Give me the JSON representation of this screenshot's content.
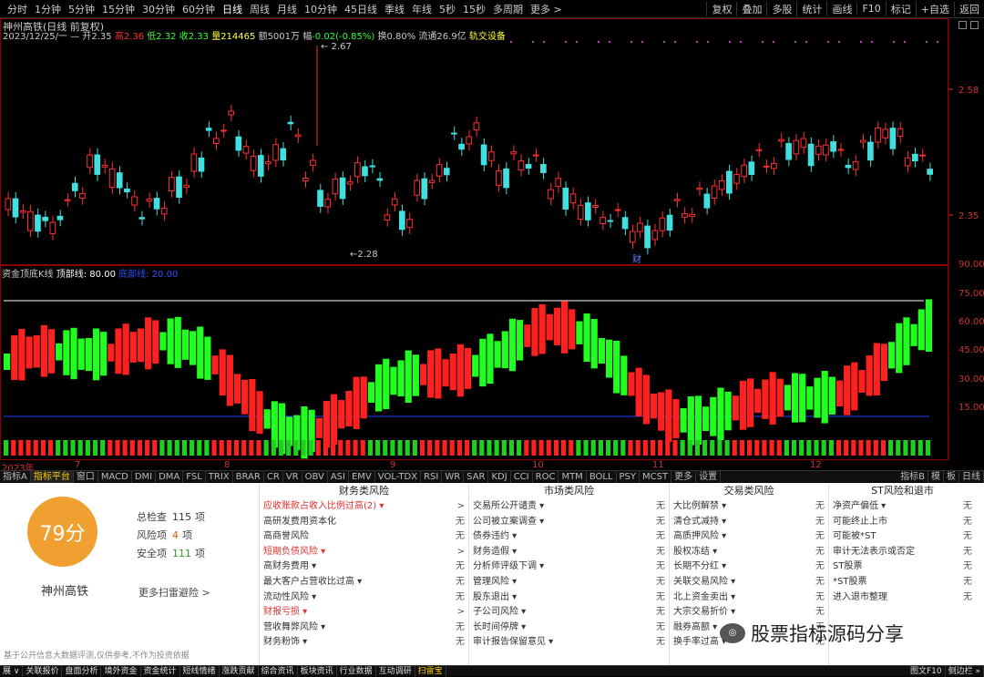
{
  "toolbar": {
    "periods": [
      "分时",
      "1分钟",
      "5分钟",
      "15分钟",
      "30分钟",
      "60分钟",
      "日线",
      "周线",
      "月线",
      "10分钟",
      "45日线",
      "季线",
      "年线",
      "5秒",
      "15秒",
      "多周期",
      "更多 >"
    ],
    "active_period": "日线",
    "right_buttons": [
      "复权",
      "叠加",
      "多股",
      "统计",
      "画线",
      "F10",
      "标记",
      "+自选",
      "返回"
    ]
  },
  "info": {
    "title": "神州高铁(日线 前复权)",
    "date": "2023/12/25/一",
    "open_label": "开",
    "open": "2.35",
    "high_label": "高",
    "high": "2.36",
    "low_label": "低",
    "low": "2.32",
    "close_label": "收",
    "close": "2.33",
    "vol_label": "量",
    "vol": "214465",
    "amount_label": "额",
    "amount": "5001万",
    "change_label": "幅",
    "change": "-0.02(-0.85%)",
    "turnover_label": "换",
    "turnover": "0.80%",
    "float_label": "流通",
    "float": "26.9亿",
    "sector": "轨交设备"
  },
  "price_axis": {
    "labels": [
      "2.58",
      "2.35"
    ]
  },
  "price_annotations": {
    "high": "2.67",
    "low": "2.28",
    "event": "财"
  },
  "indicator": {
    "name": "资金顶底K线",
    "line_label": "顶部线: 80.00",
    "extra_label": "底部线: 20.00",
    "axis_labels": [
      "90.00",
      "75.00",
      "60.00",
      "45.00",
      "30.00",
      "15.00"
    ]
  },
  "x_axis": {
    "year_label": "2023年",
    "months": [
      "7",
      "8",
      "9",
      "10",
      "11",
      "12"
    ]
  },
  "indicator_tabs": [
    "指标A",
    "指标平台",
    "窗口",
    "MACD",
    "DMI",
    "DMA",
    "FSL",
    "TRIX",
    "BRAR",
    "CR",
    "VR",
    "OBV",
    "ASI",
    "EMV",
    "VOL-TDX",
    "RSI",
    "WR",
    "SAR",
    "KDJ",
    "CCI",
    "ROC",
    "MTM",
    "BOLL",
    "PSY",
    "MCST",
    "更多",
    "设置"
  ],
  "active_tab": "指标平台",
  "tabs_right": [
    "指标B",
    "模",
    "板",
    "日线"
  ],
  "risk_panel": {
    "score": "79分",
    "company": "神州高铁",
    "summary": [
      {
        "label": "总检查",
        "value": "115",
        "unit": "项",
        "style": "normal"
      },
      {
        "label": "风险项",
        "value": "4",
        "unit": "项",
        "style": "red"
      },
      {
        "label": "安全项",
        "value": "111",
        "unit": "项",
        "style": "green"
      }
    ],
    "more_link": "更多扫雷避险 >",
    "columns": [
      {
        "title": "财务类风险",
        "rows": [
          {
            "label": "应收账款占收入比例过高(2) ▾",
            "value": ">",
            "risk": true
          },
          {
            "label": "高研发费用资本化",
            "value": "无",
            "risk": false
          },
          {
            "label": "高商誉风险",
            "value": "无",
            "risk": false
          },
          {
            "label": "短期负债风险 ▾",
            "value": ">",
            "risk": true
          },
          {
            "label": "高财务费用 ▾",
            "value": "无",
            "risk": false
          },
          {
            "label": "最大客户占营收比过高 ▾",
            "value": "无",
            "risk": false
          },
          {
            "label": "流动性风险 ▾",
            "value": "无",
            "risk": false
          },
          {
            "label": "财报亏损 ▾",
            "value": ">",
            "risk": true
          },
          {
            "label": "营收舞弊风险 ▾",
            "value": "无",
            "risk": false
          },
          {
            "label": "财务粉饰 ▾",
            "value": "无",
            "risk": false
          }
        ]
      },
      {
        "title": "市场类风险",
        "rows": [
          {
            "label": "交易所公开谴责 ▾",
            "value": "无",
            "risk": false
          },
          {
            "label": "公司被立案调查 ▾",
            "value": "无",
            "risk": false
          },
          {
            "label": "债券违约 ▾",
            "value": "无",
            "risk": false
          },
          {
            "label": "财务造假 ▾",
            "value": "无",
            "risk": false
          },
          {
            "label": "分析师评级下调 ▾",
            "value": "无",
            "risk": false
          },
          {
            "label": "管理风险 ▾",
            "value": "无",
            "risk": false
          },
          {
            "label": "股东退出 ▾",
            "value": "无",
            "risk": false
          },
          {
            "label": "子公司风险 ▾",
            "value": "无",
            "risk": false
          },
          {
            "label": "长时间停牌 ▾",
            "value": "无",
            "risk": false
          },
          {
            "label": "审计报告保留意见 ▾",
            "value": "无",
            "risk": false
          }
        ]
      },
      {
        "title": "交易类风险",
        "rows": [
          {
            "label": "大比例解禁 ▾",
            "value": "无",
            "risk": false
          },
          {
            "label": "清仓式减持 ▾",
            "value": "无",
            "risk": false
          },
          {
            "label": "高质押风险 ▾",
            "value": "无",
            "risk": false
          },
          {
            "label": "股权冻结 ▾",
            "value": "无",
            "risk": false
          },
          {
            "label": "长期不分红 ▾",
            "value": "无",
            "risk": false
          },
          {
            "label": "关联交易风险 ▾",
            "value": "无",
            "risk": false
          },
          {
            "label": "北上资金卖出 ▾",
            "value": "无",
            "risk": false
          },
          {
            "label": "大宗交易折价 ▾",
            "value": "无",
            "risk": false
          },
          {
            "label": "融券高额 ▾",
            "value": "无",
            "risk": false
          },
          {
            "label": "换手率过高 ▾",
            "value": "无",
            "risk": false
          }
        ]
      },
      {
        "title": "ST风险和退市",
        "rows": [
          {
            "label": "净资产偏低 ▾",
            "value": "无",
            "risk": false
          },
          {
            "label": "可能终止上市",
            "value": "无",
            "risk": false
          },
          {
            "label": "可能被*ST",
            "value": "无",
            "risk": false
          },
          {
            "label": "审计无法表示或否定",
            "value": "无",
            "risk": false
          },
          {
            "label": "ST股票",
            "value": "无",
            "risk": false
          },
          {
            "label": "*ST股票",
            "value": "无",
            "risk": false
          },
          {
            "label": "进入退市整理",
            "value": "无",
            "risk": false
          }
        ]
      }
    ]
  },
  "disclaimer": "基于公开信息大数据评测,仅供参考,不作为投资依据",
  "watermark": "股票指标源码分享",
  "bottom_tabs": [
    "展 ∨",
    "关联报价",
    "盘面分析",
    "境外资金",
    "资金统计",
    "短线情绪",
    "涨跌贡献",
    "综合资讯",
    "板块资讯",
    "行业数据",
    "互动调研",
    "扫雷宝"
  ],
  "bottom_active": "扫雷宝",
  "bottom_right": [
    "图文F10",
    "侧边栏 »"
  ],
  "colors": {
    "up": "#ff2020",
    "down": "#20ff20",
    "score": "#f0a030",
    "risk_text": "#e03030"
  }
}
